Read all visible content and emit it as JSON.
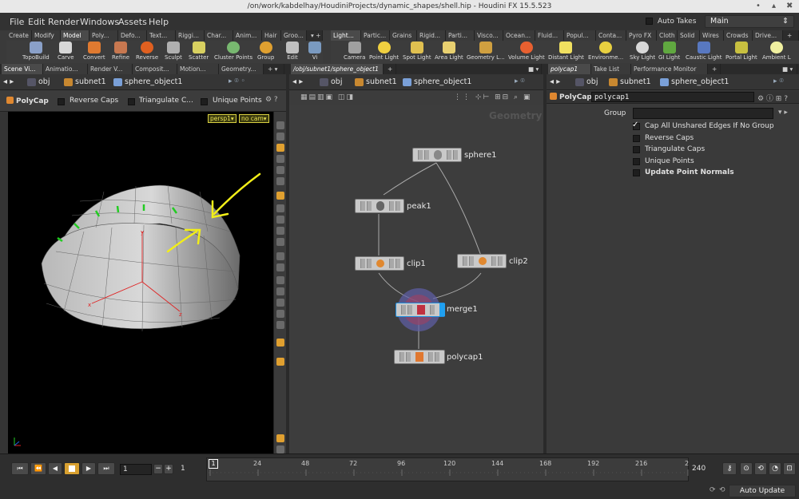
{
  "window": {
    "title": "/on/work/kabdelhay/HoudiniProjects/dynamic_shapes/shell.hip - Houdini FX 15.5.523",
    "controls": [
      "•",
      "▴",
      "✖"
    ]
  },
  "menu": {
    "items": [
      "File",
      "Edit",
      "Render",
      "Windows",
      "Assets",
      "Help"
    ],
    "auto_takes": "Auto Takes",
    "desktop": "Main"
  },
  "shelf_left": {
    "tabs": [
      "Create",
      "Modify",
      "Model",
      "Poly...",
      "Defo...",
      "Text...",
      "Riggi...",
      "Char...",
      "Anim...",
      "Hair",
      "Groo..."
    ],
    "tools": [
      "TopoBuild",
      "Carve",
      "Convert",
      "Refine",
      "Reverse",
      "Sculpt",
      "Scatter",
      "Cluster Points",
      "Group",
      "Edit",
      "Vi"
    ]
  },
  "shelf_right": {
    "tabs": [
      "Light...",
      "Partic...",
      "Grains",
      "Rigid...",
      "Parti...",
      "Visco...",
      "Ocean...",
      "Fluid...",
      "Popul...",
      "Conta...",
      "Pyro FX",
      "Cloth",
      "Solid",
      "Wires",
      "Crowds",
      "Drive..."
    ],
    "tools": [
      "Camera",
      "Point Light",
      "Spot Light",
      "Area Light",
      "Geometry L...",
      "Volume Light",
      "Distant Light",
      "Environme...",
      "Sky Light",
      "GI Light",
      "Caustic Light",
      "Portal Light",
      "Ambient L"
    ]
  },
  "left_pane": {
    "tabs": [
      "Scene Vi...",
      "Animatio...",
      "Render V...",
      "Composit...",
      "Motion...",
      "Geometry..."
    ],
    "path": [
      "obj",
      "subnet1",
      "sphere_object1"
    ],
    "tool_name": "PolyCap",
    "options": [
      "Reverse Caps",
      "Triangulate C...",
      "Unique Points"
    ],
    "cam_persp": "persp1▾",
    "cam_nocam": "no cam▾"
  },
  "network_pane": {
    "tab": "/obj/subnet1/sphere_object1",
    "path": [
      "obj",
      "subnet1",
      "sphere_object1"
    ],
    "context_label": "Geometry",
    "nodes": [
      "sphere1",
      "peak1",
      "clip1",
      "clip2",
      "merge1",
      "polycap1"
    ]
  },
  "params_pane": {
    "tabs": [
      "polycap1",
      "Take List",
      "Performance Monitor"
    ],
    "path": [
      "obj",
      "subnet1",
      "sphere_object1"
    ],
    "node_type": "PolyCap",
    "node_name": "polycap1",
    "group_label": "Group",
    "group_value": "",
    "toggles": [
      {
        "label": "Cap All Unshared Edges If No Group",
        "checked": true
      },
      {
        "label": "Reverse Caps",
        "checked": false
      },
      {
        "label": "Triangulate Caps",
        "checked": false
      },
      {
        "label": "Unique Points",
        "checked": false
      },
      {
        "label": "Update Point Normals",
        "checked": false
      }
    ]
  },
  "timeline": {
    "frame": "1",
    "start": "1",
    "ticks": [
      "1",
      "24",
      "48",
      "72",
      "96",
      "120",
      "144",
      "168",
      "192",
      "216",
      "2"
    ],
    "end": "240",
    "auto_update": "Auto Update"
  },
  "colors": {
    "annotation": "#f2ee18",
    "accent_green": "#22cc22"
  }
}
